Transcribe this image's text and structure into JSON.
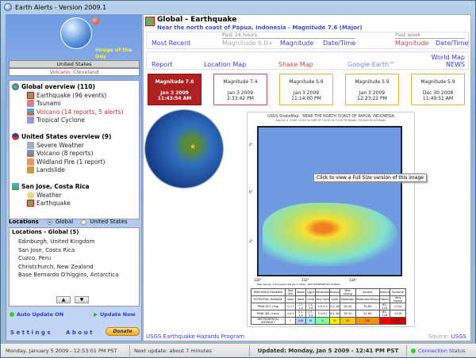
{
  "window": {
    "title": "Earth Alerts - Version 2009.1"
  },
  "left": {
    "image_of_day": "Image of the Day",
    "region": "United States",
    "featured": "Volcano: Cleveland",
    "global": {
      "title": "Global overview (110)",
      "items": [
        "Earthquake (96 events)",
        "Tsunami",
        "Volcano (14 reports, 5 alerts)",
        "Tropical Cyclone"
      ]
    },
    "us": {
      "title": "United States overview (9)",
      "items": [
        "Severe Weather",
        "Volcano (8 reports)",
        "Wildland Fire (1 report)",
        "Landslide"
      ]
    },
    "local": {
      "title": "San Jose, Costa Rica",
      "items": [
        "Weather",
        "Earthquake"
      ]
    },
    "locations_label": "Locations",
    "radio_global": "Global",
    "radio_us": "United States",
    "locations_title": "Locations - Global (5)",
    "locations": [
      "Edinburgh, United Kingdom",
      "San Jose, Costa Rica",
      "Cuzco, Peru",
      "Christchurch, New Zealand",
      "Base Bernardo O'higgins, Antarctica"
    ],
    "auto_update": "Auto Update ON",
    "update_now": "Update Now",
    "settings": "Settings",
    "about": "About",
    "donate": "Donate"
  },
  "main": {
    "title": "Global - Earthquake",
    "subtitle": "Near the north coast of Papua, Indonesia - Magnitude 7.6 (Major)",
    "most_recent": "Most Recent",
    "past24": "Past 24 hours",
    "mag60": "Magnitude 6.0+",
    "magnitude": "Magnitude",
    "datetime": "Date/Time",
    "pastweek": "Past week",
    "links": {
      "report": "Report",
      "location_map": "Location Map",
      "shake_map": "Shake Map",
      "google_earth": "Google Earth™",
      "world_map": "World Map",
      "news": "NEWS"
    },
    "quakes": [
      {
        "mag": "Magnitude 7.6",
        "date": "Jan 3 2009",
        "time": "11:43:54 AM"
      },
      {
        "mag": "Magnitude 7.4",
        "date": "Jan 3 2009",
        "time": "2:33:42 PM"
      },
      {
        "mag": "Magnitude 5.9",
        "date": "Jan 3 2009",
        "time": "11:14:00 PM"
      },
      {
        "mag": "Magnitude 5.9",
        "date": "Jan 3 2009",
        "time": "12:23:22 PM"
      },
      {
        "mag": "Magnitude 5.9",
        "date": "Dec 30 2008",
        "time": "11:49:51 AM"
      }
    ],
    "shakemap": {
      "title": "USGS ShakeMap : NEAR THE NORTH COAST OF PAPUA, INDONESIA",
      "info": "Sat Jan 3, 2009 19:43:54 GMT  M 7.6  S0.51 E132.78  Depth: 35.0km  ID:2009bjm",
      "lat_labels": [
        "2°",
        "0°",
        "-2°"
      ],
      "lon_labels": [
        "130°",
        "132°",
        "134°"
      ],
      "footer": "Map Version 1 Processed Sat Jan 3, 2009 - NOT REVIEWED BY HUMAN",
      "rows": [
        [
          "PERCEIVED SHAKING",
          "Not felt",
          "Weak",
          "Light",
          "Moderate",
          "Strong",
          "Very strong",
          "Severe",
          "Violent",
          "Extreme"
        ],
        [
          "POTENTIAL DAMAGE",
          "none",
          "none",
          "none",
          "Very light",
          "Light",
          "Moderate",
          "Moderate/Heavy",
          "Heavy",
          "Very Heavy"
        ],
        [
          "PEAK ACC.(%g)",
          "<.17",
          ".17-1.4",
          "1.4-3.9",
          "3.9-9.2",
          "9.2-18",
          "18-34",
          "34-65",
          "65-124",
          ">124"
        ],
        [
          "PEAK VEL.(cm/s)",
          "<0.1",
          "0.1-1.1",
          "1.1-3.4",
          "3.4-8.1",
          "8.1-16",
          "16-31",
          "31-60",
          "60-116",
          ">116"
        ],
        [
          "INSTRUMENTAL INTENSITY",
          "I",
          "II-III",
          "IV",
          "V",
          "VI",
          "VII",
          "VIII",
          "IX",
          "X+"
        ]
      ]
    },
    "tooltip": "Click to view a Full Size version of this image",
    "hazards_link": "USGS Earthquake Hazards Program",
    "source_label": "Source:",
    "source": "USGS"
  },
  "status": {
    "clock": "Monday, January 5 2009 - 12:53:01 PM PST",
    "next_update": "Next update: about 7 minutes",
    "updated": "Updated: Monday, Jan 5 2009 - 12:41 PM PST",
    "connection": "Connection Status"
  }
}
